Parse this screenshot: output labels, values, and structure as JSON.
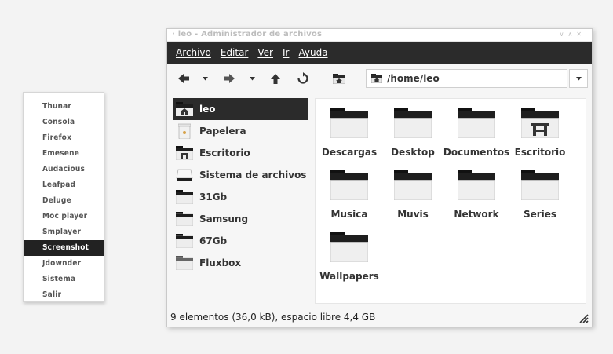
{
  "root_menu": {
    "items": [
      {
        "label": "Thunar"
      },
      {
        "label": "Consola"
      },
      {
        "label": "Firefox"
      },
      {
        "label": "Emesene"
      },
      {
        "label": "Audacious"
      },
      {
        "label": "Leafpad"
      },
      {
        "label": "Deluge"
      },
      {
        "label": "Moc player"
      },
      {
        "label": "Smplayer"
      },
      {
        "label": "Screenshot"
      },
      {
        "label": "Jdownder"
      },
      {
        "label": "Sistema"
      },
      {
        "label": "Salir"
      }
    ],
    "selected": "Screenshot"
  },
  "window": {
    "title": "leo - Administrador de archivos",
    "menu": [
      "Archivo",
      "Editar",
      "Ver",
      "Ir",
      "Ayuda"
    ],
    "toolbar": {
      "back": "back-arrow-icon",
      "forward": "forward-arrow-icon",
      "up": "up-arrow-icon",
      "reload": "reload-icon",
      "home": "home-folder-icon"
    },
    "path": "/home/leo",
    "side_pane": [
      {
        "label": "leo",
        "icon": "home-folder-icon",
        "active": true
      },
      {
        "label": "Papelera",
        "icon": "trash-icon"
      },
      {
        "label": "Escritorio",
        "icon": "desktop-folder-icon"
      },
      {
        "label": "Sistema de archivos",
        "icon": "drive-icon"
      },
      {
        "label": "31Gb",
        "icon": "folder-icon"
      },
      {
        "label": "Samsung",
        "icon": "folder-icon"
      },
      {
        "label": "67Gb",
        "icon": "folder-icon"
      },
      {
        "label": "Fluxbox",
        "icon": "folder-icon"
      }
    ],
    "files": [
      {
        "name": "Descargas",
        "icon": "folder-icon"
      },
      {
        "name": "Desktop",
        "icon": "folder-icon"
      },
      {
        "name": "Documentos",
        "icon": "folder-icon"
      },
      {
        "name": "Escritorio",
        "icon": "desktop-folder-icon"
      },
      {
        "name": "Musica",
        "icon": "folder-icon"
      },
      {
        "name": "Muvis",
        "icon": "folder-icon"
      },
      {
        "name": "Network",
        "icon": "folder-icon"
      },
      {
        "name": "Series",
        "icon": "folder-icon"
      },
      {
        "name": "Wallpapers",
        "icon": "folder-icon"
      }
    ],
    "status": "9 elementos (36,0 kB), espacio libre 4,4 GB"
  },
  "colors": {
    "menubar_bg": "#2b2b2b",
    "selection_bg": "#222222",
    "folder_tab": "#1e1e1e",
    "folder_body": "#efefef"
  }
}
